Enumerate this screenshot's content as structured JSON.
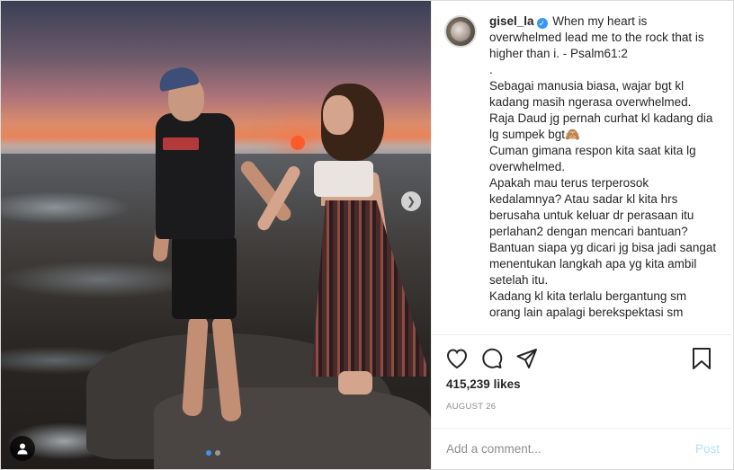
{
  "post": {
    "username": "gisel_la",
    "verified": true,
    "caption_lines": [
      "When my heart is overwhelmed lead me to the rock that is higher than i. - Psalm61:2",
      ".",
      "Sebagai manusia biasa, wajar bgt kl kadang masih ngerasa overwhelmed.",
      "Raja Daud jg pernah curhat kl kadang dia lg sumpek bgt🙈",
      "Cuman gimana respon kita saat kita lg overwhelmed.",
      "Apakah mau terus terperosok kedalamnya? Atau sadar kl kita hrs berusaha untuk keluar dr perasaan itu perlahan2 dengan mencari bantuan?",
      "Bantuan siapa yg dicari jg bisa jadi sangat menentukan langkah apa yg kita ambil setelah itu.",
      "Kadang kl kita terlalu bergantung sm orang lain apalagi berekspektasi sm"
    ],
    "likes_count": "415,239",
    "likes_word": "likes",
    "date": "AUGUST 26"
  },
  "carousel": {
    "current_slide": 1,
    "total_slides": 2
  },
  "actions": {
    "icons": [
      "heart-icon",
      "comment-icon",
      "share-icon",
      "bookmark-icon"
    ]
  },
  "comment": {
    "placeholder": "Add a comment...",
    "post_label": "Post"
  },
  "colors": {
    "accent_blue": "#3897f0",
    "post_disabled": "#b2dffc",
    "muted_text": "#8e8e8e"
  }
}
